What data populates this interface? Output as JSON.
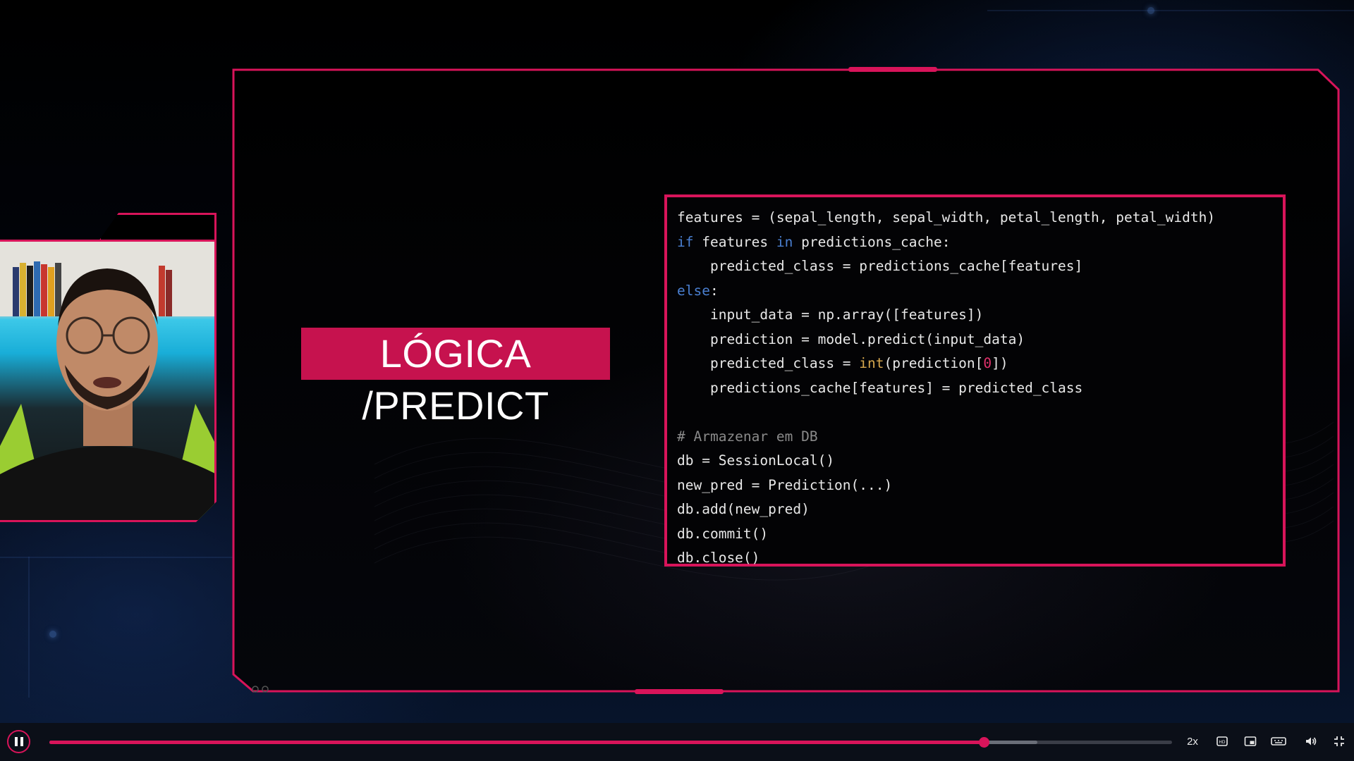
{
  "slide": {
    "title": "LÓGICA /PREDICT"
  },
  "code": {
    "lines": [
      "features = (sepal_length, sepal_width, petal_length, petal_width)",
      "if features in predictions_cache:",
      "    predicted_class = predictions_cache[features]",
      "else:",
      "    input_data = np.array([features])",
      "    prediction = model.predict(input_data)",
      "    predicted_class = int(prediction[0])",
      "    predictions_cache[features] = predicted_class",
      "",
      "# Armazenar em DB",
      "db = SessionLocal()",
      "new_pred = Prediction(...)",
      "db.add(new_pred)",
      "db.commit()",
      "db.close()"
    ]
  },
  "player": {
    "progress": 0.832,
    "buffered": 0.88,
    "speed_label": "2x",
    "icons": [
      "pause-icon",
      "hd-icon",
      "picture-in-picture-icon",
      "keyboard-icon",
      "volume-icon",
      "exit-fullscreen-icon"
    ]
  },
  "colors": {
    "accent": "#d8145a",
    "title_bg": "#c6124e",
    "keyword": "#4a7fd0",
    "builtin": "#d7a84e",
    "number": "#e0306b",
    "comment": "#8a8a8a"
  }
}
